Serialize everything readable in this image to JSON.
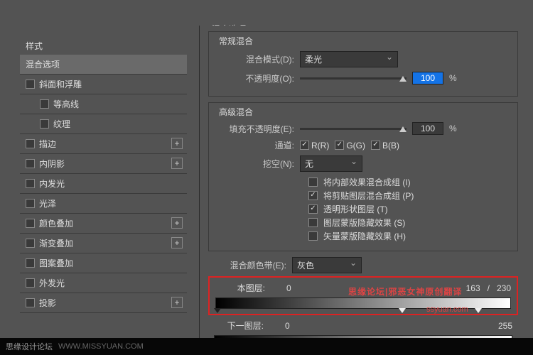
{
  "sidebar": {
    "header": "样式",
    "items": [
      {
        "label": "混合选项",
        "selected": true
      },
      {
        "label": "斜面和浮雕",
        "plus": false,
        "check": true
      },
      {
        "label": "等高线",
        "indent": true,
        "check": true
      },
      {
        "label": "纹理",
        "indent": true,
        "check": true
      },
      {
        "label": "描边",
        "plus": true,
        "check": true
      },
      {
        "label": "内阴影",
        "plus": true,
        "check": true
      },
      {
        "label": "内发光",
        "plus": false,
        "check": true
      },
      {
        "label": "光泽",
        "plus": false,
        "check": true
      },
      {
        "label": "颜色叠加",
        "plus": true,
        "check": true
      },
      {
        "label": "渐变叠加",
        "plus": true,
        "check": true
      },
      {
        "label": "图案叠加",
        "plus": false,
        "check": true
      },
      {
        "label": "外发光",
        "plus": false,
        "check": true
      },
      {
        "label": "投影",
        "plus": true,
        "check": true
      }
    ]
  },
  "main": {
    "title": "混合选项",
    "general": {
      "group_title": "常规混合",
      "blend_mode_label": "混合模式(D):",
      "blend_mode_value": "柔光",
      "opacity_label": "不透明度(O):",
      "opacity_value": "100",
      "pct": "%"
    },
    "advanced": {
      "group_title": "高级混合",
      "fill_label": "填充不透明度(E):",
      "fill_value": "100",
      "pct": "%",
      "channels_label": "通道:",
      "ch_r": "R(R)",
      "ch_g": "G(G)",
      "ch_b": "B(B)",
      "knockout_label": "挖空(N):",
      "knockout_value": "无",
      "opt1": "将内部效果混合成组 (I)",
      "opt2": "将剪贴图层混合成组 (P)",
      "opt3": "透明形状图层 (T)",
      "opt4": "图层蒙版隐藏效果 (S)",
      "opt5": "矢量蒙版隐藏效果 (H)"
    },
    "blendif": {
      "label": "混合颜色带(E):",
      "value": "灰色",
      "this_layer": "本图层:",
      "this_b": "0",
      "this_w1": "163",
      "slash": "/",
      "this_w2": "230",
      "under_layer": "下一图层:",
      "under_b": "0",
      "under_w": "255"
    }
  },
  "watermark1": "思缘论坛|邪恶女神原创翻译",
  "watermark2": "ssyuan.com",
  "footer": {
    "site": "思缘设计论坛",
    "url": "WWW.MISSYUAN.COM"
  }
}
